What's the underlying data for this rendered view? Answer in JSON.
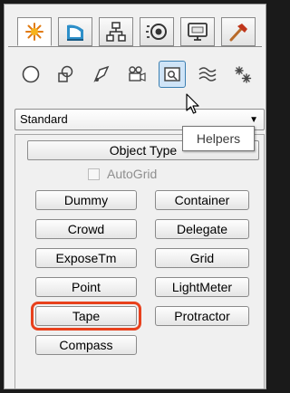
{
  "tabs": [
    {
      "icon": "create-star-icon",
      "active": true
    },
    {
      "icon": "modify-bend-icon",
      "active": false
    },
    {
      "icon": "hierarchy-icon",
      "active": false
    },
    {
      "icon": "motion-icon",
      "active": false
    },
    {
      "icon": "display-monitor-icon",
      "active": false
    },
    {
      "icon": "utilities-hammer-icon",
      "active": false
    }
  ],
  "categories": [
    {
      "icon": "geometry-sphere-icon",
      "active": false
    },
    {
      "icon": "shapes-icon",
      "active": false
    },
    {
      "icon": "lights-icon",
      "active": false
    },
    {
      "icon": "cameras-icon",
      "active": false
    },
    {
      "icon": "helpers-icon",
      "active": true
    },
    {
      "icon": "space-warps-icon",
      "active": false
    },
    {
      "icon": "systems-icon",
      "active": false
    }
  ],
  "dropdown": {
    "value": "Standard"
  },
  "tooltip": {
    "text": "Helpers"
  },
  "rollout": {
    "title": "Object Type",
    "autogrid_label": "AutoGrid",
    "buttons_left": [
      "Dummy",
      "Crowd",
      "ExposeTm",
      "Point",
      "Tape",
      "Compass"
    ],
    "buttons_right": [
      "Container",
      "Delegate",
      "Grid",
      "LightMeter",
      "Protractor"
    ],
    "selected": "Tape"
  },
  "colors": {
    "highlight": "#e8411d",
    "active_category": "#cfe4f7"
  }
}
